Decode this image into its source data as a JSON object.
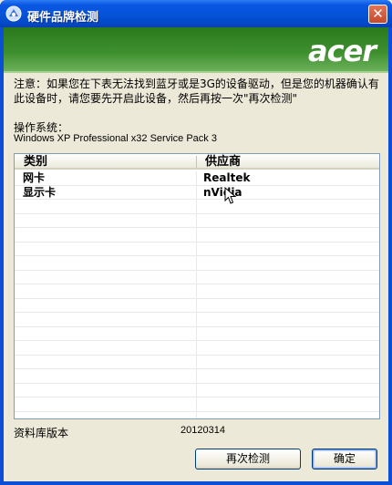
{
  "window": {
    "title": "硬件品牌检测",
    "close_label": "✕"
  },
  "banner": {
    "logo": "acer",
    "color": "#3e8f2e"
  },
  "notice": "注意：如果您在下表无法找到蓝牙或是3G的设备驱动，但是您的机器确认有此设备时，请您要先开启此设备，然后再按一次\"再次检测\"",
  "os": {
    "label": "操作系统：",
    "value": "Windows XP Professional x32 Service Pack 3"
  },
  "table": {
    "columns": [
      "类别",
      "供应商"
    ],
    "rows": [
      {
        "category": "网卡",
        "vendor": "Realtek"
      },
      {
        "category": "显示卡",
        "vendor": "nVidia"
      }
    ]
  },
  "database": {
    "label": "资料库版本",
    "value": "20120314"
  },
  "buttons": {
    "rescan": "再次检测",
    "ok": "确定"
  }
}
